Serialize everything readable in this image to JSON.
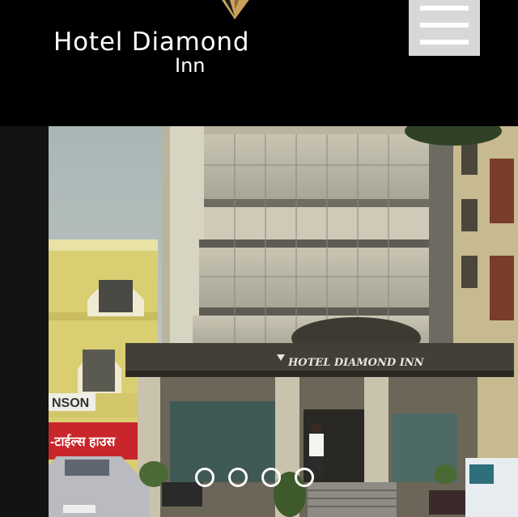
{
  "header": {
    "logo": {
      "name": "Hotel Diamond",
      "sub": "Inn",
      "emblem_icon": "diamond-logo-icon"
    },
    "menu_button": {
      "icon": "hamburger-menu-icon"
    }
  },
  "slider": {
    "current_slide": 1,
    "slide_count": 4,
    "building_sign": "HOTEL DIAMOND INN",
    "neighbor_sign": "NSON",
    "neighbor_sign_red": "-टाईल्स हाउस",
    "dots": [
      {
        "index": 1,
        "active": false
      },
      {
        "index": 2,
        "active": false
      },
      {
        "index": 3,
        "active": false
      },
      {
        "index": 4,
        "active": false
      }
    ]
  },
  "colors": {
    "header_bg": "#000000",
    "menu_button_bg": "#d8d8d8",
    "dot_border": "#ffffff"
  }
}
